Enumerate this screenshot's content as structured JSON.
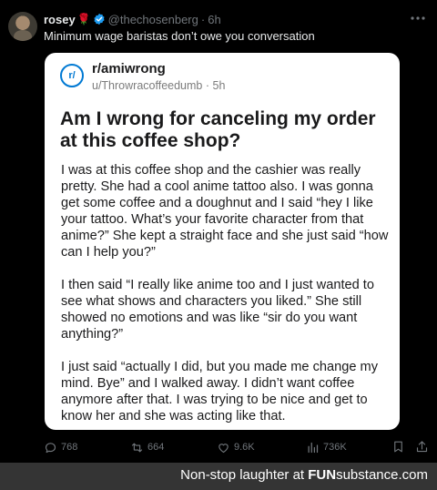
{
  "tweet": {
    "display_name": "rosey",
    "emoji": "🌹",
    "handle": "@thechosenberg",
    "separator": "·",
    "time": "6h",
    "text": "Minimum wage baristas don’t owe you conversation",
    "icons": {
      "avatar": "user-avatar",
      "verified": "verified-badge-icon",
      "more": "more-icon"
    }
  },
  "reddit_post": {
    "subreddit": "r/amiwrong",
    "subreddit_icon_text": "r/",
    "author": "u/Throwracoffeedumb",
    "separator": "·",
    "age": "5h",
    "title": "Am I wrong for canceling my order at this coffee shop?",
    "paragraphs": [
      "I was at this coffee shop and the cashier was really pretty. She had a cool anime tattoo also. I was gonna get some coffee and a doughnut and I said “hey I like your tattoo. What’s your favorite character from that anime?” She kept a straight face and she just said “how can I help you?”",
      "I then said “I really like anime too and I just wanted to see what shows and characters you liked.” She still showed no emotions and was like “sir do you want anything?”",
      "I just said “actually I did, but you made me change my mind. Bye” and I walked away. I didn’t want coffee anymore after that. I was trying to be nice and get to know her and she was acting like that."
    ]
  },
  "actions": {
    "replies": "768",
    "reposts": "664",
    "likes": "9.6K",
    "views": "736K",
    "icons": [
      "reply-icon",
      "repost-icon",
      "like-icon",
      "views-icon",
      "bookmark-icon",
      "share-icon"
    ]
  },
  "footer": {
    "prefix": "Non-stop laughter at",
    "brand_fun": "FUN",
    "brand_substance": "substance",
    "brand_suffix": ".com"
  },
  "colors": {
    "background": "#000000",
    "muted": "#71767b",
    "verified": "#1d9bf0",
    "reddit_blue": "#0079d3",
    "footer_bg": "#343434"
  }
}
